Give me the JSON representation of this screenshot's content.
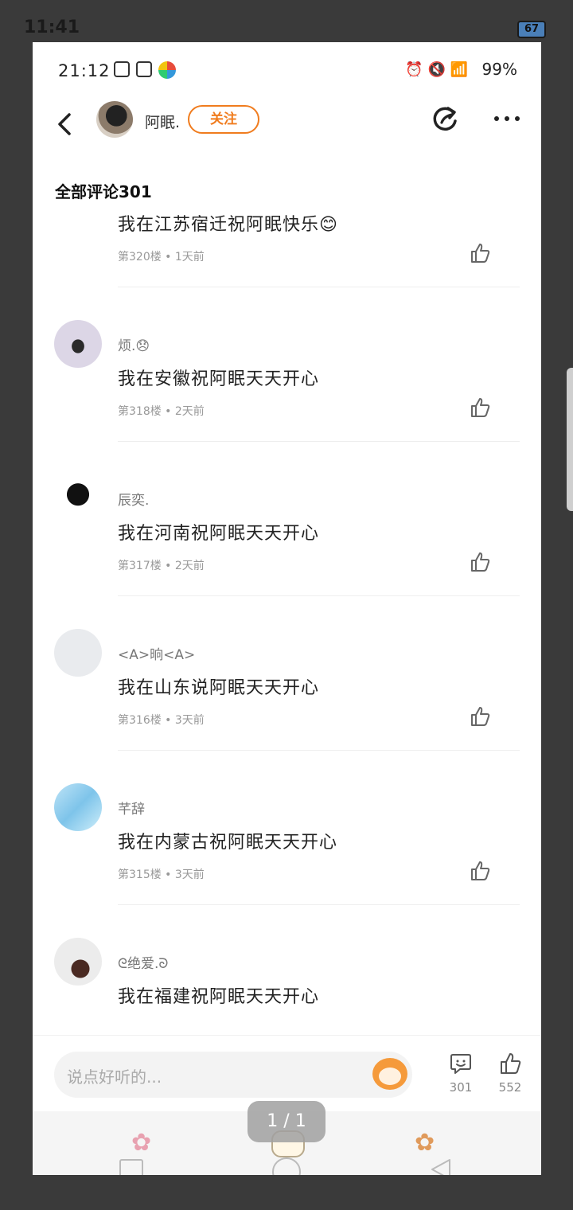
{
  "outer_status": {
    "time": "11:41",
    "battery": "67"
  },
  "inner_status": {
    "time": "21:12",
    "battery": "99%"
  },
  "header": {
    "username": "阿眠.",
    "follow_label": "关注"
  },
  "section_title": "全部评论301",
  "comments": [
    {
      "user": "",
      "text": "我在江苏宿迁祝阿眠快乐😊",
      "meta": "第320楼 • 1天前"
    },
    {
      "user": "烦.😞",
      "text": "我在安徽祝阿眠天天开心",
      "meta": "第318楼 • 2天前"
    },
    {
      "user": "辰奕.",
      "text": "我在河南祝阿眠天天开心",
      "meta": "第317楼 • 2天前"
    },
    {
      "user": "<A>晌<A>",
      "text": "我在山东说阿眠天天开心",
      "meta": "第316楼 • 3天前"
    },
    {
      "user": "芊辞",
      "text": "我在内蒙古祝阿眠天天开心",
      "meta": "第315楼 • 3天前"
    },
    {
      "user": "ᘓ绝爱.ᘐ",
      "text": "我在福建祝阿眠天天开心",
      "meta": ""
    }
  ],
  "input": {
    "placeholder": "说点好听的..."
  },
  "counts": {
    "comments": "301",
    "likes": "552"
  },
  "page_indicator": "1 / 1",
  "colors": {
    "accent": "#f07c1e"
  }
}
